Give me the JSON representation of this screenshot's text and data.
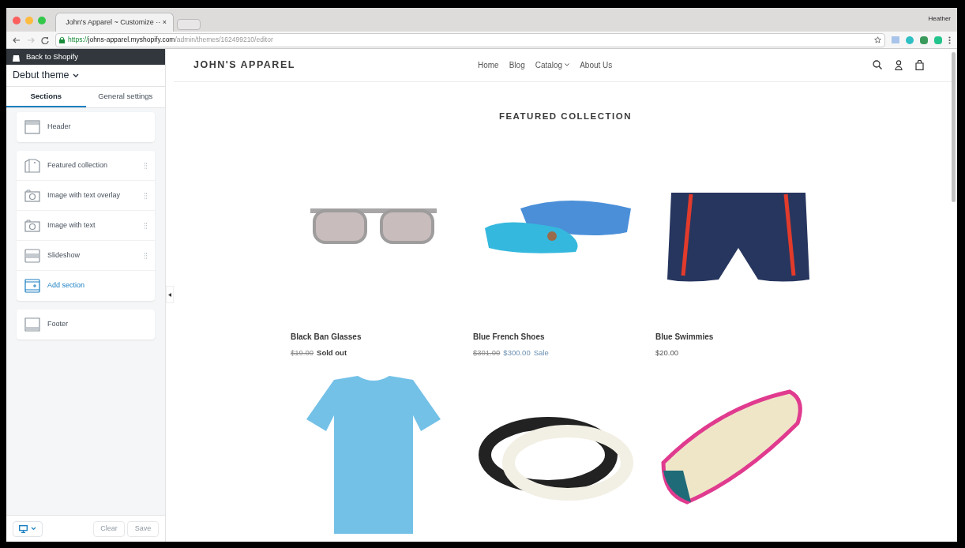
{
  "browser": {
    "tab_title": "John's Apparel ~ Customize ·· ×",
    "user": "Heather",
    "url_host": "https://johns-apparel.myshopify.com",
    "url_path": "/admin/themes/162499210/editor"
  },
  "sidebar": {
    "back_link": "Back to Shopify",
    "theme_name": "Debut theme",
    "tabs": [
      {
        "label": "Sections",
        "selected": true
      },
      {
        "label": "General settings",
        "selected": false
      }
    ],
    "groups": [
      [
        {
          "kind": "header",
          "label": "Header"
        }
      ],
      [
        {
          "kind": "collection",
          "label": "Featured collection"
        },
        {
          "kind": "camera",
          "label": "Image with text overlay"
        },
        {
          "kind": "camera",
          "label": "Image with text"
        },
        {
          "kind": "slideshow",
          "label": "Slideshow"
        },
        {
          "kind": "add",
          "label": "Add section"
        }
      ],
      [
        {
          "kind": "footer",
          "label": "Footer"
        }
      ]
    ],
    "footer_buttons": [
      "Clear",
      "Save"
    ]
  },
  "store": {
    "logo": "JOHN'S APPAREL",
    "nav": [
      {
        "label": "Home",
        "dropdown": false
      },
      {
        "label": "Blog",
        "dropdown": false
      },
      {
        "label": "Catalog",
        "dropdown": true
      },
      {
        "label": "About Us",
        "dropdown": false
      }
    ],
    "collection_title": "FEATURED COLLECTION",
    "products": [
      {
        "kind": "sold_out",
        "name": "Black Ban Glasses",
        "compare_price": "$19.00",
        "status": "Sold out"
      },
      {
        "kind": "sale",
        "name": "Blue French Shoes",
        "compare_price": "$301.00",
        "price": "$300.00",
        "status": "Sale"
      },
      {
        "kind": "regular",
        "name": "Blue Swimmies",
        "price": "$20.00"
      },
      {
        "kind": "image_only"
      },
      {
        "kind": "image_only"
      },
      {
        "kind": "image_only"
      }
    ]
  }
}
